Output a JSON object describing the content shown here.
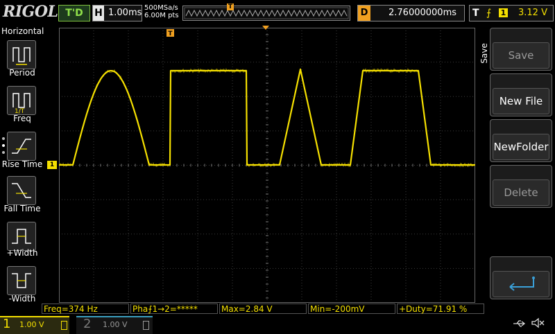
{
  "brand": "RIGOL",
  "status": {
    "run_state": "T'D"
  },
  "horizontal": {
    "key": "H",
    "timebase": "1.00ms"
  },
  "sampling": {
    "rate": "500MSa/s",
    "memory": "6.00M pts"
  },
  "delay": {
    "key": "D",
    "value": "2.76000000ms"
  },
  "trigger": {
    "key": "T",
    "edge": "⨍",
    "channel": "1",
    "level": "3.12 V",
    "marker": "T"
  },
  "left_menu": {
    "title": "Horizontal",
    "items": [
      {
        "label": "Period",
        "icon": "period-icon"
      },
      {
        "label": "Freq",
        "icon": "freq-icon"
      },
      {
        "label": "Rise Time",
        "icon": "rise-time-icon"
      },
      {
        "label": "Fall Time",
        "icon": "fall-time-icon"
      },
      {
        "label": "+Width",
        "icon": "positive-width-icon"
      },
      {
        "label": "-Width",
        "icon": "negative-width-icon"
      }
    ]
  },
  "right_menu": {
    "tab": "Save",
    "buttons": [
      {
        "label": "Save",
        "enabled": false
      },
      {
        "label": "New File",
        "enabled": true
      },
      {
        "label": "NewFolder",
        "enabled": true
      },
      {
        "label": "Delete",
        "enabled": false
      }
    ],
    "enter_icon": "enter-return-icon"
  },
  "measurements": [
    {
      "text": "Freq=374 Hz"
    },
    {
      "text": "Pha⨍1→2=*****"
    },
    {
      "text": "Max=2.84 V"
    },
    {
      "text": "Min=-200mV"
    },
    {
      "text": "+Duty=71.91 %"
    }
  ],
  "channels": [
    {
      "num": "1",
      "scale": "1.00 V",
      "color": "#f5e000"
    },
    {
      "num": "2",
      "scale": "1.00 V",
      "color": "#3a9fc0"
    }
  ],
  "ch1_marker": "1",
  "colors": {
    "trace": "#f5e000",
    "grid": "#3c3c3c",
    "accent": "#f0a020"
  }
}
